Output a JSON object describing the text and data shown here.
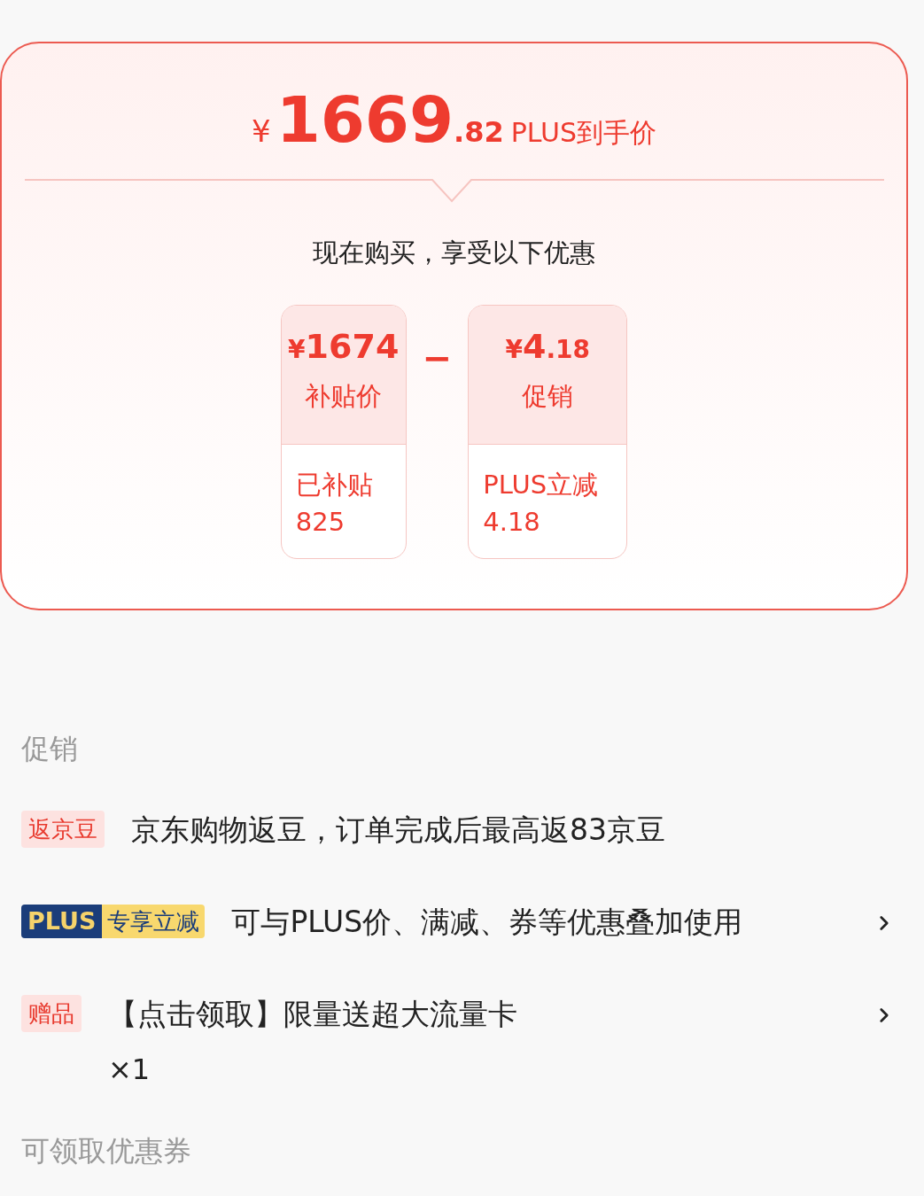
{
  "price_card": {
    "currency": "¥",
    "integer": "1669",
    "decimal": ".82",
    "label": "PLUS到手价",
    "subtitle": "现在购买，享受以下优惠",
    "operator": "−",
    "items": [
      {
        "currency": "¥",
        "amount": "1674",
        "label": "补贴价",
        "note": "已补贴",
        "note_value": "825"
      },
      {
        "currency": "¥",
        "amount": "4",
        "amount_decimal": ".18",
        "label": "促销",
        "note": "PLUS立减",
        "note_value": "4.18"
      }
    ]
  },
  "promotions": {
    "title": "促销",
    "rows": [
      {
        "kind": "tag",
        "tag": "返京豆",
        "text": "京东购物返豆，订单完成后最高返83京豆",
        "arrow": false
      },
      {
        "kind": "plus",
        "tag": "PLUS",
        "tag_extra": "专享立减",
        "text": "可与PLUS价、满减、券等优惠叠加使用",
        "arrow": true
      },
      {
        "kind": "tag",
        "tag": "赠品",
        "text": "【点击领取】限量送超大流量卡",
        "extra": "×1",
        "arrow": true
      }
    ]
  },
  "coupons": {
    "title": "可领取优惠券"
  }
}
